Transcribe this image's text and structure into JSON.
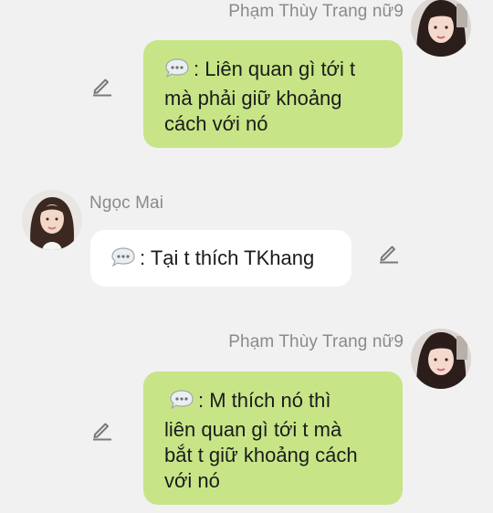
{
  "messages": [
    {
      "side": "right",
      "sender": "Phạm Thùy Trang nữ9",
      "lines": [
        ": Liên quan gì tới t",
        "mà phải giữ khoảng",
        "cách với nó"
      ]
    },
    {
      "side": "left",
      "sender": "Ngọc Mai",
      "lines": [
        ": Tại t thích TKhang"
      ]
    },
    {
      "side": "right",
      "sender": "Phạm Thùy Trang nữ9",
      "lines": [
        ": M thích nó thì",
        "liên quan gì tới t mà",
        "bắt t giữ khoảng cách",
        "với nó"
      ]
    }
  ],
  "icons": {
    "bubble": "speech-bubble-icon",
    "edit": "pencil-icon"
  },
  "colors": {
    "background": "#f1f1f1",
    "outgoing_bubble": "#c7e587",
    "incoming_bubble": "#ffffff",
    "sender_name": "#8a8a8a",
    "text": "#1b1b1b"
  }
}
